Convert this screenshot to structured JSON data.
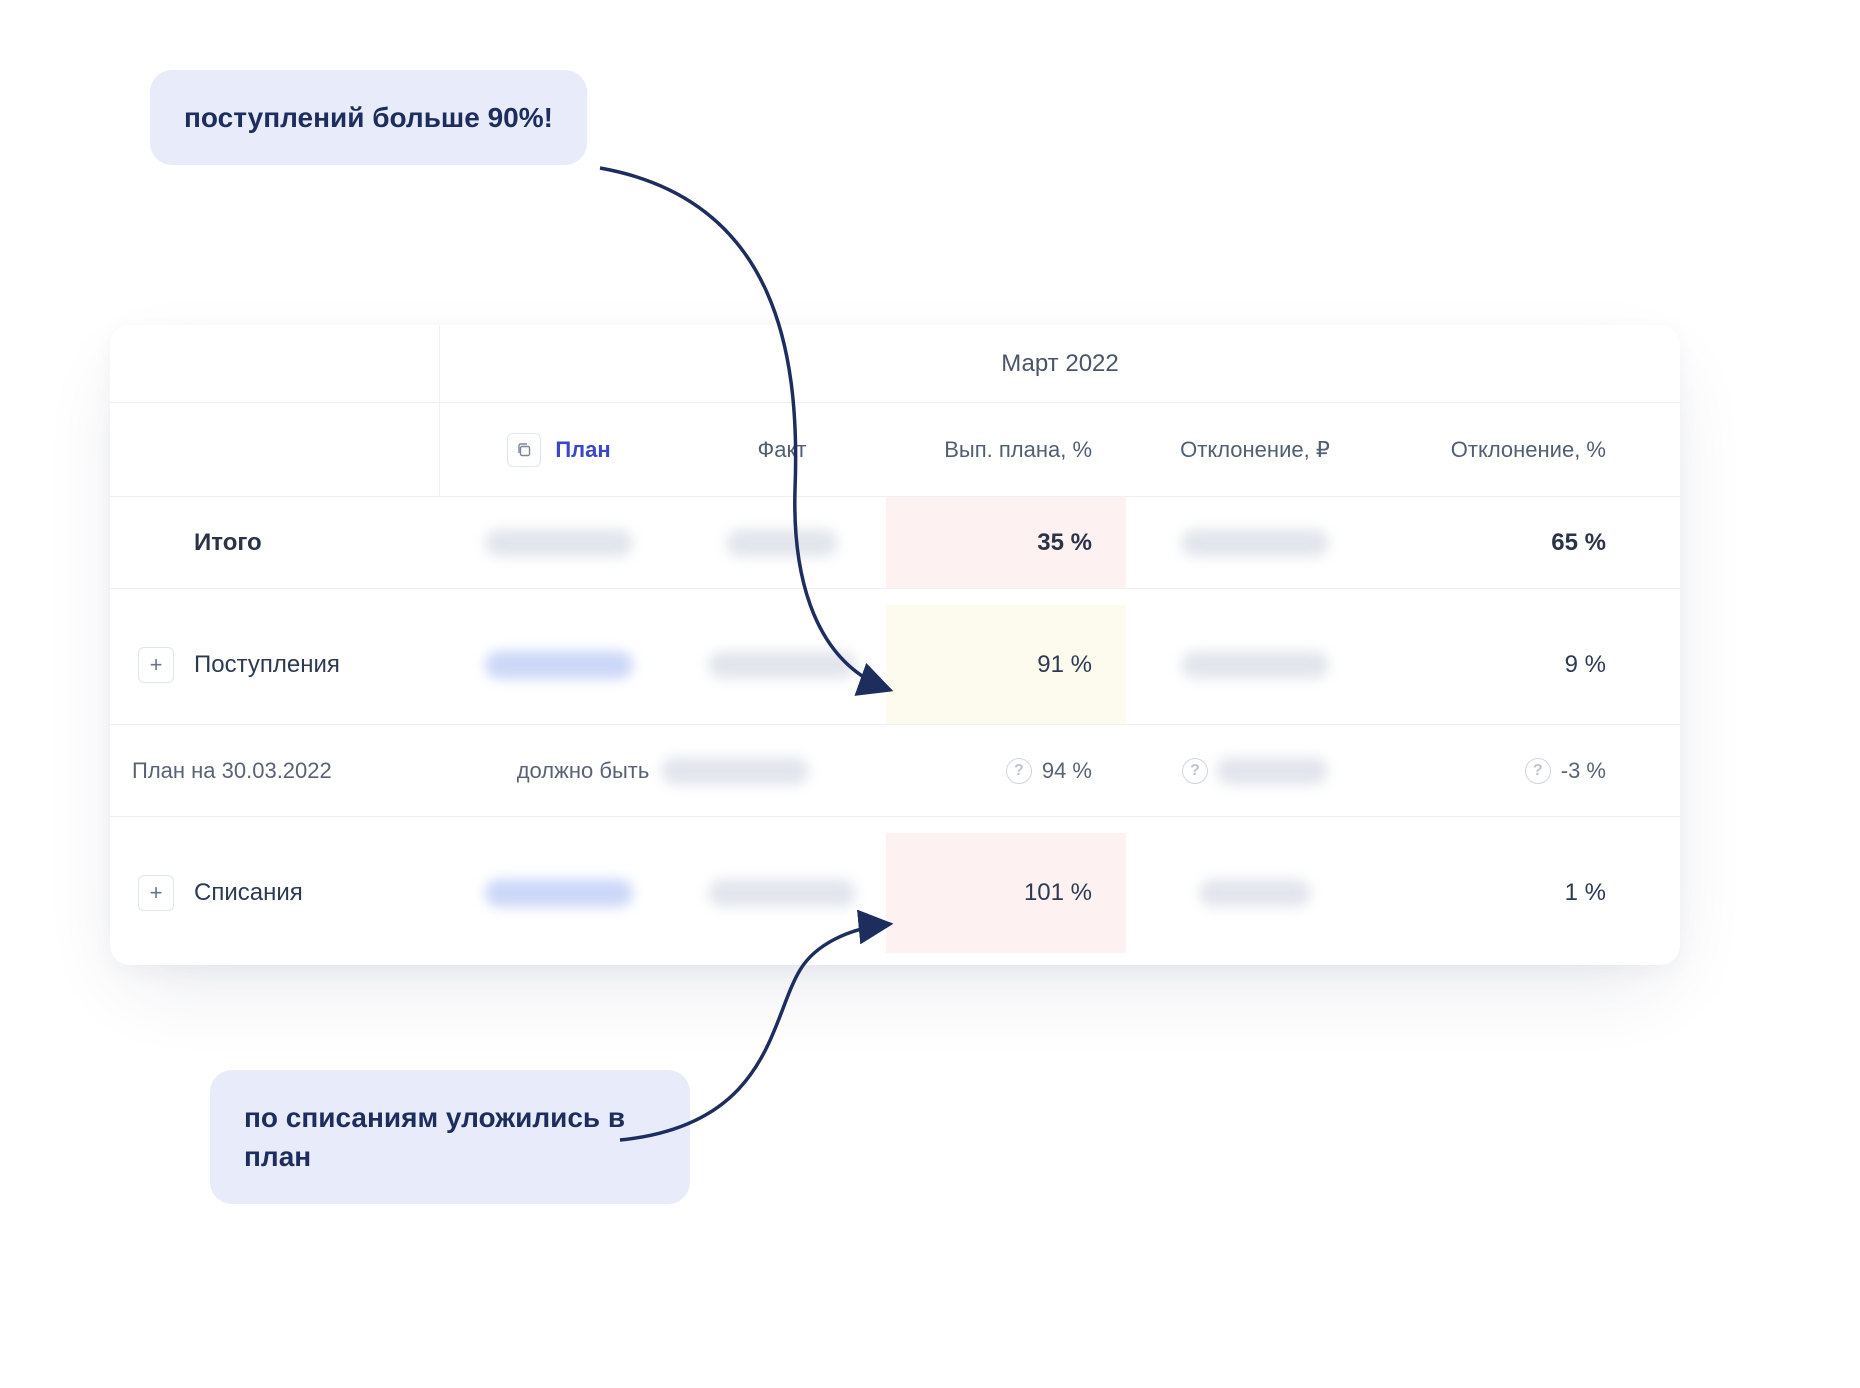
{
  "callouts": {
    "top": "поступлений больше 90%!",
    "bottom": "по списаниям уложились в план"
  },
  "table": {
    "period": "Март 2022",
    "headers": {
      "plan": "План",
      "fact": "Факт",
      "plan_pct": "Вып. плана, %",
      "dev_rub": "Отклонение, ₽",
      "dev_pct": "Отклонение, %"
    },
    "total": {
      "label": "Итого",
      "plan_pct": "35 %",
      "dev_pct": "65 %"
    },
    "receipts": {
      "label": "Поступления",
      "plan_pct": "91 %",
      "dev_pct": "9 %"
    },
    "plan_on": {
      "label": "План на 30.03.2022",
      "should_be": "должно быть",
      "plan_pct": "94 %",
      "dev_pct": "-3 %"
    },
    "writeoffs": {
      "label": "Списания",
      "plan_pct": "101 %",
      "dev_pct": "1 %"
    }
  },
  "icons": {
    "expand": "+",
    "help": "?"
  }
}
